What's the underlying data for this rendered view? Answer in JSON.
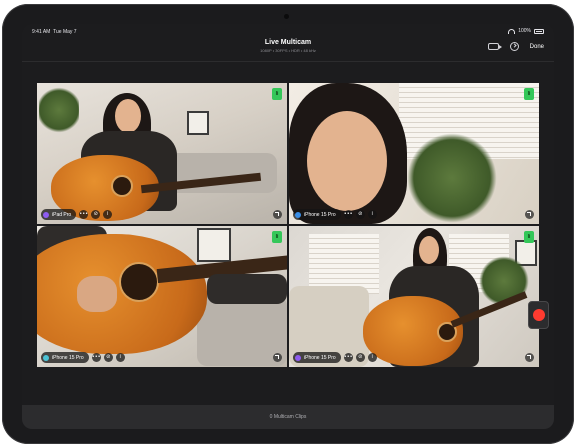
{
  "status_bar": {
    "time": "9:41 AM",
    "date": "Tue May 7",
    "battery": "100%"
  },
  "nav": {
    "title": "Live Multicam",
    "subtitle": "1080P • 30FPS • HDR • 48 kHz",
    "done_label": "Done"
  },
  "feeds": [
    {
      "device": "iPad Pro",
      "live_badge": "li",
      "more": "•••",
      "mute": "⊘",
      "info": "i"
    },
    {
      "device": "iPhone 15 Pro",
      "live_badge": "li",
      "more": "•••",
      "mute": "⊘",
      "info": "i"
    },
    {
      "device": "iPhone 15 Pro",
      "live_badge": "li",
      "more": "•••",
      "mute": "⊘",
      "info": "i"
    },
    {
      "device": "iPhone 15 Pro",
      "live_badge": "li",
      "more": "•••",
      "mute": "⊘",
      "info": "i"
    }
  ],
  "bottom_bar": {
    "clips_label": "0 Multicam Clips"
  },
  "colors": {
    "record": "#ff3b30",
    "live": "#34c759",
    "background": "#1c1c1e"
  }
}
